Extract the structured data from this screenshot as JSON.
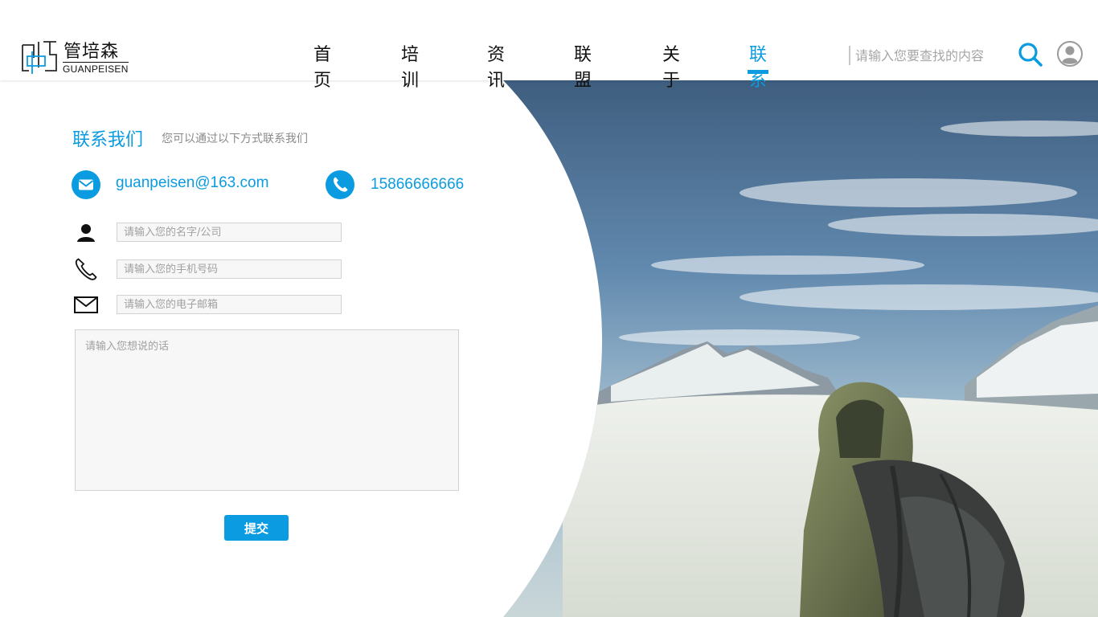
{
  "brand": {
    "name_cn": "管培森",
    "name_en": "GUANPEISEN",
    "accent": "#0a9be0"
  },
  "nav": {
    "items": [
      {
        "label": "首页",
        "active": false
      },
      {
        "label": "培训",
        "active": false
      },
      {
        "label": "资讯",
        "active": false
      },
      {
        "label": "联盟",
        "active": false
      },
      {
        "label": "关于",
        "active": false
      },
      {
        "label": "联系",
        "active": true
      }
    ]
  },
  "search": {
    "placeholder": "请输入您要查找的内容",
    "icon": "search-icon"
  },
  "user": {
    "icon": "user-avatar-icon"
  },
  "contact": {
    "title": "联系我们",
    "subtitle": "您可以通过以下方式联系我们",
    "email": "guanpeisen@163.com",
    "phone": "15866666666"
  },
  "form": {
    "name_placeholder": "请输入您的名字/公司",
    "phone_placeholder": "请输入您的手机号码",
    "email_placeholder": "请输入您的电子邮箱",
    "message_placeholder": "请输入您想说的话",
    "submit_label": "提交"
  },
  "hero": {
    "image": "mountaineer-with-backpack-snowy-peaks",
    "sky_color": "#5f86ad",
    "snow_color": "#e8ece6"
  }
}
